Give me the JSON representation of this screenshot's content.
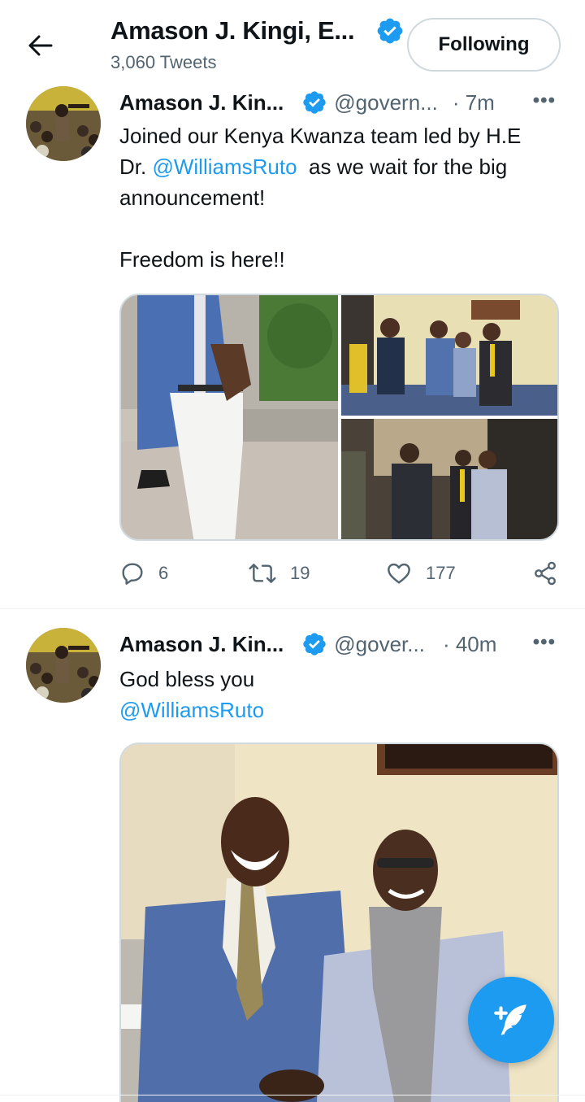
{
  "header": {
    "name": "Amason J. Kingi, E...",
    "tweet_count": "3,060 Tweets",
    "follow_label": "Following"
  },
  "tweets": [
    {
      "author": "Amason J. Kin...",
      "handle": "@govern...",
      "time": "· 7m",
      "text_line1": "Joined our Kenya Kwanza team led by H.E",
      "text_line2_pre": "Dr. ",
      "mention": "@WilliamsRuto",
      "text_line2_post": "  as we wait for the big",
      "text_line3": "announcement!",
      "text_line4": "Freedom is here!!",
      "replies": "6",
      "retweets": "19",
      "likes": "177"
    },
    {
      "author": "Amason J. Kin...",
      "handle": "@gover...",
      "time": "· 40m",
      "text_line1": "God bless you",
      "mention": "@WilliamsRuto"
    }
  ],
  "icons": {
    "back": "arrow-left-icon",
    "verified": "verified-badge-icon",
    "more": "more-icon",
    "reply": "reply-icon",
    "retweet": "retweet-icon",
    "like": "heart-icon",
    "share": "share-icon",
    "compose": "compose-tweet-icon"
  },
  "colors": {
    "accent": "#1d9bf0",
    "secondary_text": "#536471",
    "border": "#cfd9de"
  }
}
